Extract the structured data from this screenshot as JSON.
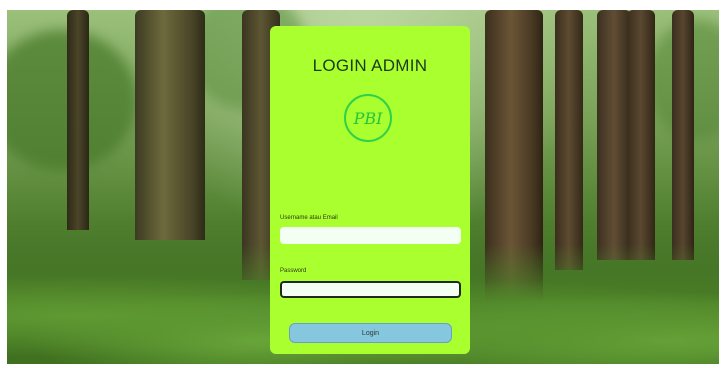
{
  "login": {
    "title": "LOGIN ADMIN",
    "logo_text": "PBI",
    "username_label": "Username atau Email",
    "username_value": "",
    "password_label": "Password",
    "password_value": "",
    "login_button": "Login"
  },
  "colors": {
    "card_background": "#aaff2e",
    "logo_green": "#23c43e",
    "button_background": "#86c7e0",
    "title_color": "#1d3a1a"
  }
}
